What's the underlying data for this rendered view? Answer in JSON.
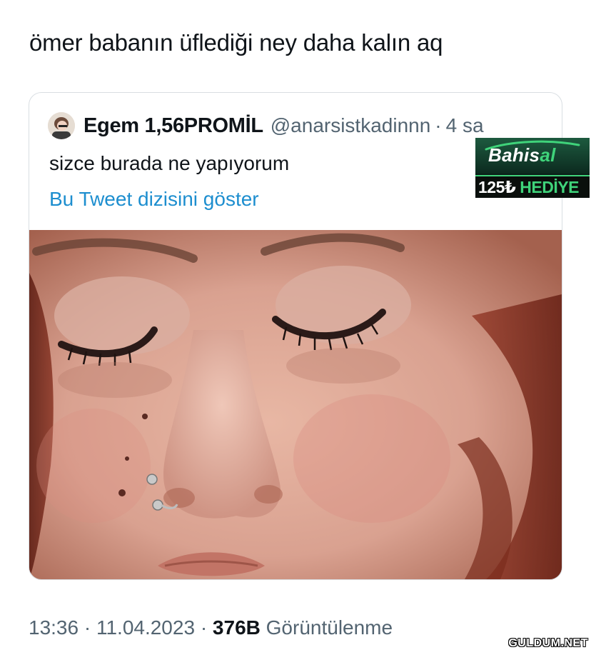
{
  "tweet": {
    "text": "ömer babanın üflediği ney daha kalın aq"
  },
  "quoted_tweet": {
    "display_name": "Egem 1,56PROMİL",
    "handle": "@anarsistkadinnn",
    "separator": "·",
    "time_ago": "4 sa",
    "text": "sizce burada ne yapıyorum",
    "thread_link": "Bu Tweet dizisini göster"
  },
  "ad": {
    "brand_main": "Bahis",
    "brand_accent": "al",
    "offer_amount": "125₺",
    "offer_label": "HEDİYE",
    "accent_color": "#3fd37a"
  },
  "meta": {
    "time": "13:36",
    "separator": "·",
    "date": "11.04.2023",
    "views_count": "376B",
    "views_label": "Görüntülenme"
  },
  "watermark": {
    "text": "GULDUM.NET"
  },
  "colors": {
    "text_primary": "#0f1419",
    "text_secondary": "#536471",
    "link": "#1d8ecf",
    "border": "#d9dee2"
  },
  "icons": {
    "avatar": "user-avatar-photo"
  }
}
